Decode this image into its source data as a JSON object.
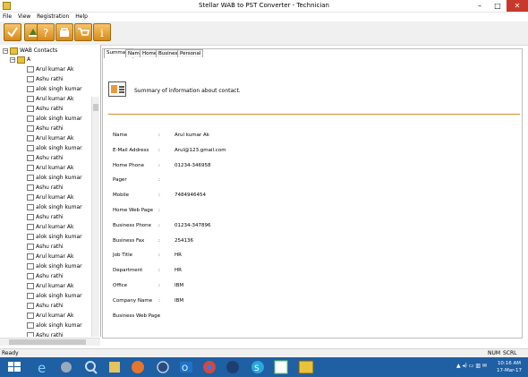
{
  "window": {
    "title": "Stellar WAB to PST Converter - Technician"
  },
  "menu": [
    "File",
    "View",
    "Registration",
    "Help"
  ],
  "toolbar": [
    {
      "name": "convert-button",
      "icon": "check-icon"
    },
    {
      "name": "save-button",
      "icon": "save-icon"
    },
    {
      "name": "help-button",
      "icon": "question-icon"
    },
    {
      "name": "register-button",
      "icon": "key-icon"
    },
    {
      "name": "buy-button",
      "icon": "cart-icon"
    },
    {
      "name": "info-button",
      "icon": "info-icon"
    }
  ],
  "tree": {
    "root": "WAB Contacts",
    "group": "A",
    "items": [
      "Arul kumar Ak",
      "Ashu rathi",
      "alok singh kumar",
      "Arul kumar Ak",
      "Ashu rathi",
      "alok singh kumar",
      "Ashu rathi",
      "Arul kumar Ak",
      "alok singh kumar",
      "Ashu rathi",
      "Arul kumar Ak",
      "alok singh kumar",
      "Ashu rathi",
      "Arul kumar Ak",
      "alok singh kumar",
      "Ashu rathi",
      "Arul kumar Ak",
      "alok singh kumar",
      "Ashu rathi",
      "Arul kumar Ak",
      "alok singh kumar",
      "Ashu rathi",
      "Arul kumar Ak",
      "alok singh kumar",
      "Ashu rathi",
      "Arul kumar Ak",
      "alok singh kumar",
      "Ashu rathi"
    ]
  },
  "tabs": [
    "Summary",
    "Name",
    "Home",
    "Business",
    "Personal"
  ],
  "summary": {
    "heading": "Summary of information about contact."
  },
  "fields": [
    {
      "label": "Name",
      "value": "Arul kumar Ak"
    },
    {
      "label": "E-Mail Address",
      "value": "Arul@123.gmail.com"
    },
    {
      "label": "Home Phone",
      "value": "01234-346958"
    },
    {
      "label": "Pager",
      "value": ""
    },
    {
      "label": "Mobile",
      "value": "7484946454"
    },
    {
      "label": "Home Web Page",
      "value": ""
    },
    {
      "label": "Business Phone",
      "value": "01234-347896"
    },
    {
      "label": "Business Fax",
      "value": "254136"
    },
    {
      "label": "Job Title",
      "value": "HR"
    },
    {
      "label": "Department",
      "value": "HR"
    },
    {
      "label": "Office",
      "value": "IBM"
    },
    {
      "label": "Company Name",
      "value": "IBM"
    },
    {
      "label": "Business Web Page",
      "value": ""
    }
  ],
  "field_separator": ":",
  "status": {
    "left": "Ready",
    "num": "NUM",
    "scrl": "SCRL"
  },
  "taskbar": {
    "time": "10:16 AM",
    "date": "17-Mar-17"
  },
  "colors": {
    "taskbar": "#1f5fa3",
    "accent": "#d38b2a",
    "close": "#c7392c"
  }
}
